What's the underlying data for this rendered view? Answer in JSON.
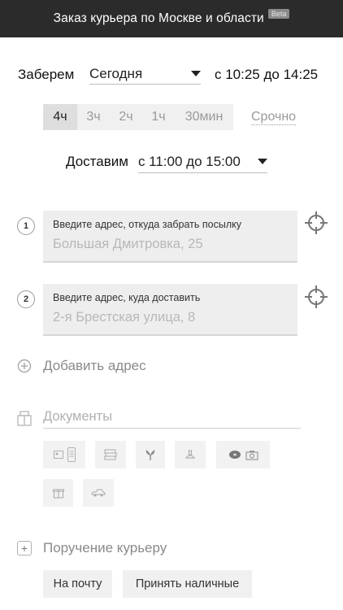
{
  "header": {
    "title": "Заказ курьера по Москве и области",
    "badge": "Beta",
    "background": "#2b2b2b"
  },
  "pickup": {
    "label": "Заберем",
    "day": "Сегодня",
    "time": "с 10:25 до 14:25"
  },
  "durations": {
    "options": [
      "4ч",
      "3ч",
      "2ч",
      "1ч",
      "30мин"
    ],
    "selected": "4ч",
    "urgent": "Срочно"
  },
  "delivery": {
    "label": "Доставим",
    "time": "с 11:00 до 15:00"
  },
  "addresses": [
    {
      "number": "1",
      "label": "Введите адрес, откуда забрать посылку",
      "placeholder": "Большая Дмитровка, 25",
      "icon": "crosshair-icon"
    },
    {
      "number": "2",
      "label": "Введите адрес, куда доставить",
      "placeholder": "2-я Брестская улица, 8",
      "icon": "crosshair-icon"
    }
  ],
  "add_address": {
    "label": "Добавить адрес"
  },
  "documents": {
    "placeholder": "Документы",
    "categories": [
      {
        "name": "documents",
        "icons": [
          "id-card-icon",
          "phone-icon"
        ]
      },
      {
        "name": "books",
        "icons": [
          "books-icon"
        ]
      },
      {
        "name": "flowers",
        "icons": [
          "flower-icon"
        ]
      },
      {
        "name": "food",
        "icons": [
          "food-icon"
        ]
      },
      {
        "name": "electronics",
        "icons": [
          "disc-icon",
          "camera-icon"
        ]
      },
      {
        "name": "gifts",
        "icons": [
          "gift-icon"
        ]
      },
      {
        "name": "auto",
        "icons": [
          "car-icon"
        ]
      }
    ]
  },
  "courier_task": {
    "label": "Поручение курьеру",
    "chips": [
      "На почту",
      "Принять наличные"
    ]
  }
}
